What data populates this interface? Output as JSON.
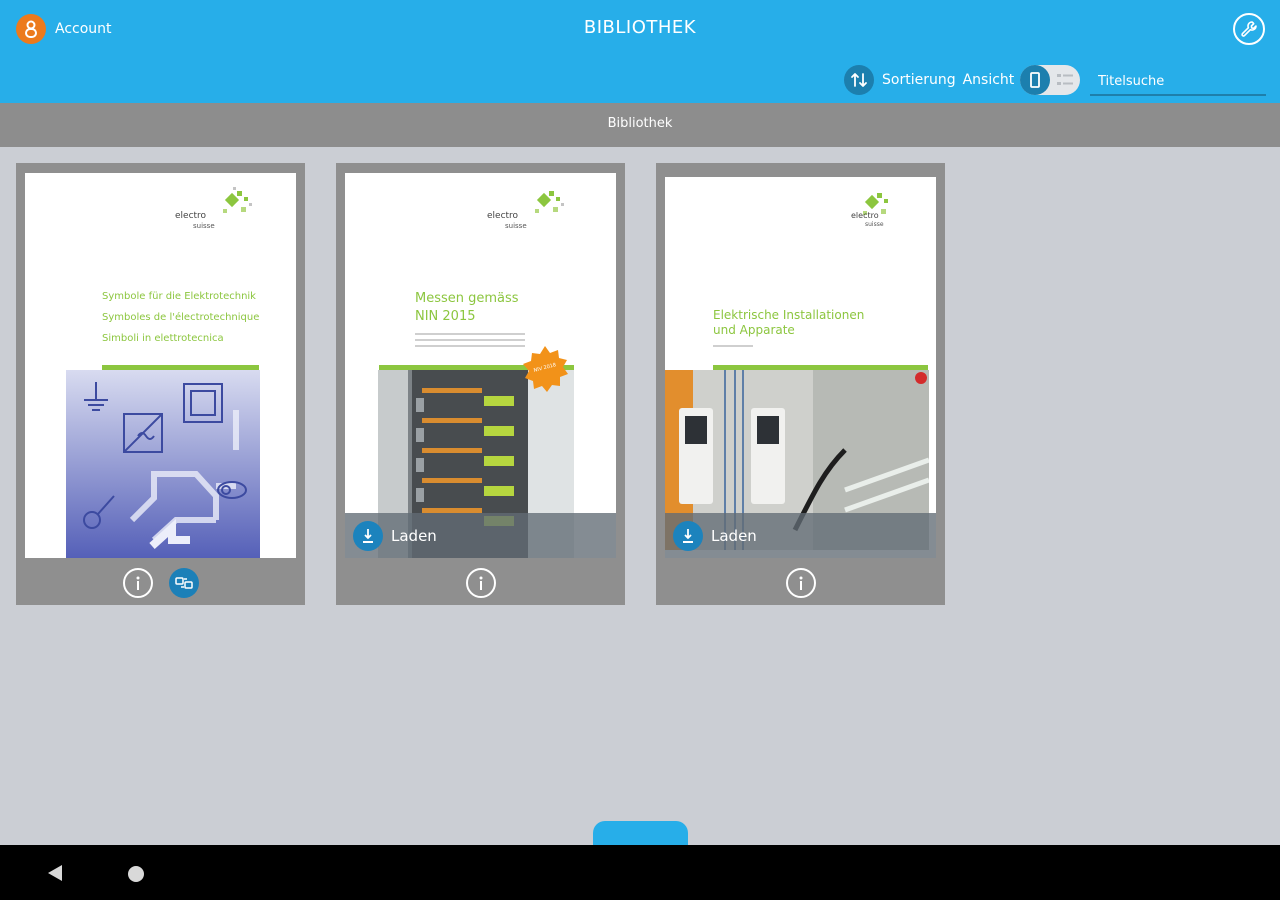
{
  "header": {
    "account_label": "Account",
    "title": "BIBLIOTHEK",
    "settings_icon": "wrench-icon",
    "sort_label": "Sortierung",
    "view_label": "Ansicht",
    "search_placeholder": "Titelsuche"
  },
  "subheader": {
    "title": "Bibliothek"
  },
  "books": [
    {
      "brand_line1": "electro",
      "brand_line2": "suisse",
      "title_lines": [
        "Symbole für die Elektrotechnik",
        "Symboles de l'électrotechnique",
        "Simboli in elettrotecnica"
      ],
      "actions": [
        "info-icon",
        "sync-icon"
      ]
    },
    {
      "brand_line1": "electro",
      "brand_line2": "suisse",
      "title_line1": "Messen gemäss",
      "title_line2": "NIN 2015",
      "badge": "NIV 2018",
      "load_label": "Laden",
      "actions": [
        "info-icon"
      ]
    },
    {
      "brand_line1": "electro",
      "brand_line2": "suisse",
      "title_line1": "Elektrische Installationen",
      "title_line2": "und Apparate",
      "load_label": "Laden",
      "actions": [
        "info-icon"
      ]
    }
  ],
  "colors": {
    "primary": "#27aee9",
    "accent": "#ec7a1c",
    "green": "#8cc63f",
    "card": "#8f8f8f"
  }
}
